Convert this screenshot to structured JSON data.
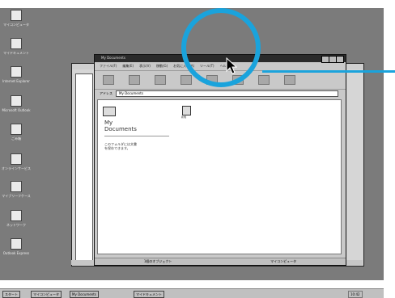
{
  "desktop": {
    "icons": [
      {
        "label": "マイコンピュータ",
        "icon": "computer-icon"
      },
      {
        "label": "マイドキュメント",
        "icon": "folder-icon"
      },
      {
        "label": "Internet Explorer",
        "icon": "globe-icon"
      },
      {
        "label": "Microsoft Outlook",
        "icon": "mail-icon"
      },
      {
        "label": "ごみ箱",
        "icon": "recycle-bin-icon"
      },
      {
        "label": "オンラインサービス",
        "icon": "online-icon"
      },
      {
        "label": "マイブリーフケース",
        "icon": "briefcase-icon"
      },
      {
        "label": "ネットワーク",
        "icon": "network-icon"
      },
      {
        "label": "Outlook Express",
        "icon": "outlook-express-icon"
      }
    ]
  },
  "explorer": {
    "title": "My Documents",
    "menu": [
      "ファイル(F)",
      "編集(E)",
      "表示(V)",
      "移動(G)",
      "お気に入り(A)",
      "ツール(T)",
      "ヘルプ(H)"
    ],
    "toolbar": [
      "back-icon",
      "forward-icon",
      "up-icon",
      "cut-icon",
      "copy-icon",
      "paste-icon",
      "undo-icon",
      "delete-icon"
    ],
    "address_label": "アドレス",
    "address_value": "My Documents",
    "folder_title_line1": "My",
    "folder_title_line2": "Documents",
    "description_line1": "このフォルダには文書",
    "description_line2": "を保存できます。",
    "file_label": "新規",
    "status_left": "1個のオブジェクト",
    "status_right": "マイコンピュータ"
  },
  "taskbar": {
    "start_label": "スタート",
    "items": [
      "マイコンピュータ",
      "My Documents",
      "マイドキュメント"
    ],
    "clock": "10:42"
  }
}
